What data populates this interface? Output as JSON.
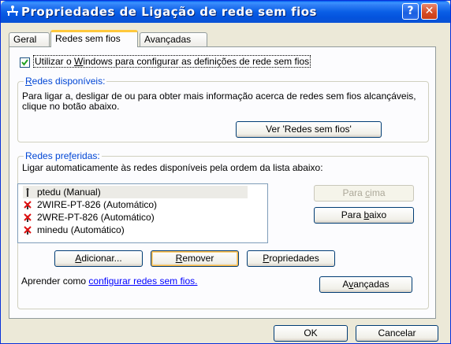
{
  "window": {
    "title": "Propriedades de Ligação de rede sem fios",
    "help_label": "?",
    "close_label": "✕"
  },
  "tabs": [
    {
      "label": "Geral"
    },
    {
      "label": "Redes sem fios"
    },
    {
      "label": "Avançadas"
    }
  ],
  "checkbox": {
    "label_pre": "Utilizar o ",
    "label_u": "W",
    "label_post": "indows para configurar as definições de rede sem fios",
    "checked": true
  },
  "available": {
    "title_u": "R",
    "title_rest": "edes disponíveis:",
    "description": "Para ligar a, desligar de ou para obter mais informação acerca de redes sem fios alcançáveis, clique no botão abaixo.",
    "view_button": "Ver 'Redes sem fios'"
  },
  "preferred": {
    "title_pre": "Redes pre",
    "title_u": "f",
    "title_post": "eridas:",
    "description": "Ligar automaticamente às redes disponíveis pela ordem da lista abaixo:",
    "networks": [
      {
        "name": "ptedu (Manual)",
        "icon": "wireless-network-icon-available"
      },
      {
        "name": "2WIRE-PT-826 (Automático)",
        "icon": "wireless-network-icon-unavailable"
      },
      {
        "name": "2WRE-PT-826 (Automático)",
        "icon": "wireless-network-icon-unavailable"
      },
      {
        "name": "minedu (Automático)",
        "icon": "wireless-network-icon-unavailable"
      }
    ],
    "up_button_pre": "Para ",
    "up_button_u": "c",
    "up_button_post": "ima",
    "down_button_pre": "Para ",
    "down_button_u": "b",
    "down_button_post": "aixo",
    "add_button_u": "A",
    "add_button_rest": "dicionar...",
    "remove_button_u": "R",
    "remove_button_rest": "emover",
    "properties_button_u": "P",
    "properties_button_rest": "ropriedades",
    "learn_text": "Aprender como ",
    "learn_link": "configurar redes sem fios.",
    "advanced_button_pre": "A",
    "advanced_button_u": "v",
    "advanced_button_post": "ançadas"
  },
  "footer": {
    "ok": "OK",
    "cancel": "Cancelar"
  },
  "colors": {
    "titlebar": "#0a5fe6",
    "group_title": "#0046d5",
    "tab_highlight": "#ffc83c",
    "link": "#0000ff"
  }
}
